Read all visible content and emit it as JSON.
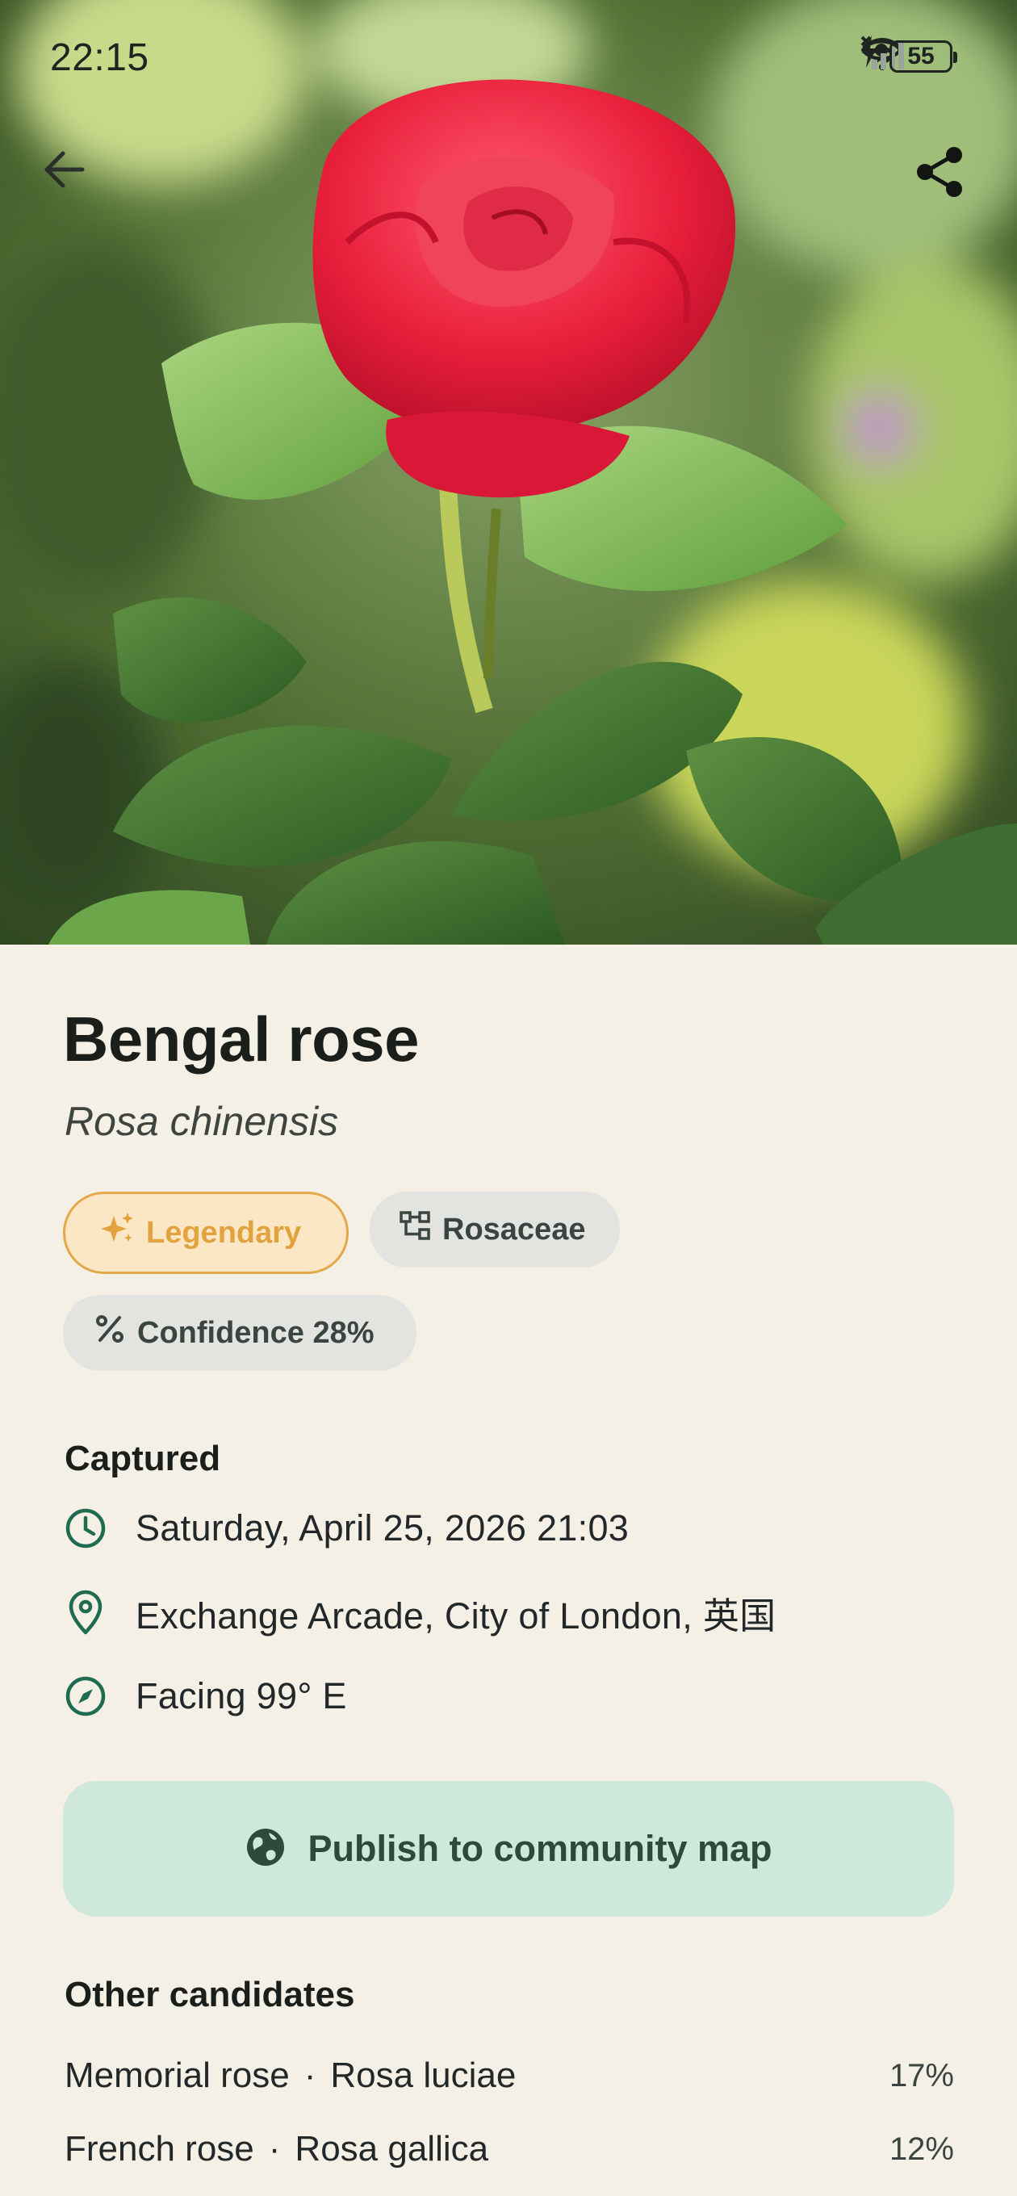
{
  "status_bar": {
    "time": "22:15",
    "battery": "55",
    "icons": [
      "eye-icon",
      "wifi-icon",
      "cellular-icon",
      "battery-icon",
      "charging-icon"
    ]
  },
  "header": {
    "back_icon": "arrow-left-icon",
    "share_icon": "share-icon"
  },
  "species": {
    "common_name": "Bengal rose",
    "scientific_name": "Rosa chinensis"
  },
  "chips": {
    "rarity": "Legendary",
    "family": "Rosaceae",
    "confidence": "Confidence 28%"
  },
  "captured": {
    "heading": "Captured",
    "datetime": "Saturday, April 25, 2026 21:03",
    "location": "Exchange Arcade, City of London, 英国",
    "facing": "Facing 99° E"
  },
  "publish": {
    "label": "Publish to community map"
  },
  "other_candidates": {
    "heading": "Other candidates",
    "items": [
      {
        "common": "Memorial rose",
        "scientific": "Rosa luciae",
        "percent": "17%"
      },
      {
        "common": "French rose",
        "scientific": "Rosa gallica",
        "percent": "12%"
      }
    ]
  },
  "colors": {
    "background": "#f5f0e6",
    "accent_green": "#1f6b52",
    "legendary_gold": "#e2a33f",
    "publish_bg": "#cfe8dc"
  }
}
